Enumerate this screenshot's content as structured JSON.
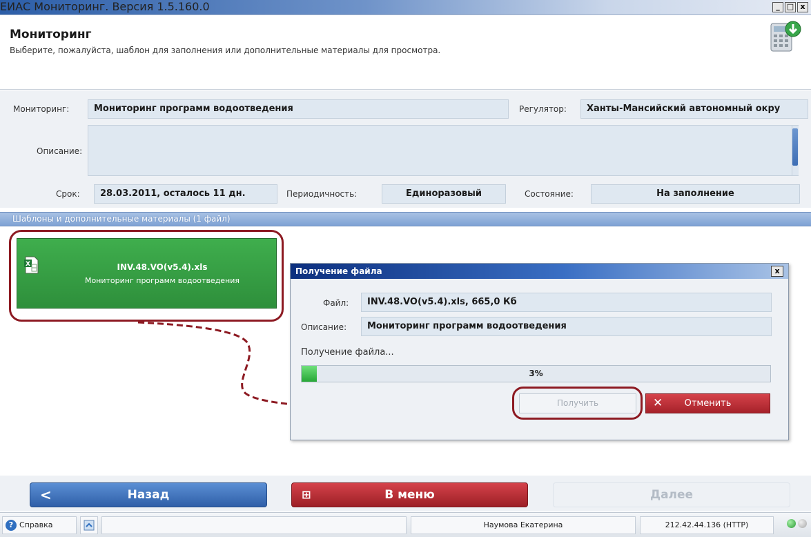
{
  "window": {
    "title": "ЕИАС Мониторинг. Версия 1.5.160.0",
    "min_glyph": "_",
    "max_glyph": "□",
    "close_glyph": "x"
  },
  "header": {
    "title": "Мониторинг",
    "subtitle": "Выберите, пожалуйста, шаблон для заполнения или дополнительные материалы для просмотра."
  },
  "form": {
    "monitoring_label": "Мониторинг:",
    "monitoring_value": "Мониторинг программ водоотведения",
    "regulator_label": "Регулятор:",
    "regulator_value": "Ханты-Мансийский автономный окру",
    "description_label": "Описание:",
    "description_value": "",
    "deadline_label": "Срок:",
    "deadline_value": "28.03.2011, осталось 11 дн.",
    "periodicity_label": "Периодичность:",
    "periodicity_value": "Единоразовый",
    "state_label": "Состояние:",
    "state_value": "На заполнение"
  },
  "templates": {
    "header": "Шаблоны и дополнительные материалы (1 файл)",
    "items": [
      {
        "file_name": "INV.48.VO(v5.4).xls",
        "description": "Мониторинг программ водоотведения"
      }
    ]
  },
  "dialog": {
    "title": "Получение файла",
    "close_glyph": "x",
    "file_label": "Файл:",
    "file_value": "INV.48.VO(v5.4).xls, 665,0 Кб",
    "description_label": "Описание:",
    "description_value": "Мониторинг программ водоотведения",
    "status_text": "Получение файла...",
    "progress_percent": 3,
    "progress_label": "3%",
    "get_label": "Получить",
    "cancel_label": "Отменить"
  },
  "nav": {
    "back_label": "Назад",
    "menu_label": "В меню",
    "next_label": "Далее"
  },
  "statusbar": {
    "help_label": "Справка",
    "user": "Наумова Екатерина",
    "server": "212.42.44.136 (HTTP)"
  },
  "colors": {
    "accent_blue": "#2f5fa8",
    "tile_green": "#2e8f3b",
    "danger_red": "#a6222a",
    "highlight_ring": "#8d1a22"
  }
}
